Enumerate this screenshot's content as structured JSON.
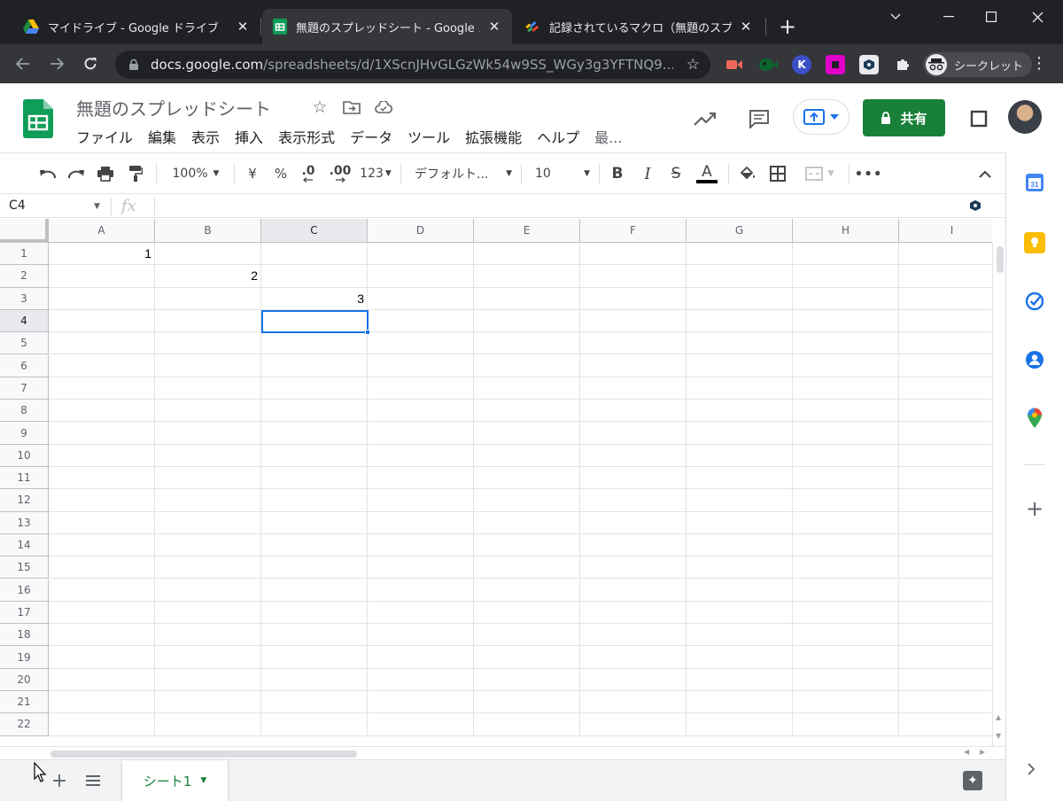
{
  "browser": {
    "tabs": [
      {
        "title": "マイドライブ - Google ドライブ",
        "active": false
      },
      {
        "title": "無題のスプレッドシート - Google スプ",
        "active": true
      },
      {
        "title": "記録されているマクロ（無題のスプレッ",
        "active": false
      }
    ],
    "url_host": "docs.google.com",
    "url_path": "/spreadsheets/d/1XScnJHvGLGzWk54w9SS_WGy3g3YFTNQ9...",
    "incognito_label": "シークレット"
  },
  "sheets": {
    "doc_title": "無題のスプレッドシート",
    "menu": [
      "ファイル",
      "編集",
      "表示",
      "挿入",
      "表示形式",
      "データ",
      "ツール",
      "拡張機能",
      "ヘルプ",
      "最..."
    ],
    "share_label": "共有",
    "brand_color": "#188038",
    "accent_color": "#1a73e8"
  },
  "toolbar": {
    "zoom": "100%",
    "currency": "¥",
    "percent": "%",
    "dec_decrease": ".0",
    "dec_increase": ".00",
    "number_format": "123",
    "font": "デフォルト...",
    "font_size": "10",
    "bold": "B",
    "italic": "I",
    "strike": "S",
    "text_color": "A"
  },
  "formula_bar": {
    "name_box": "C4",
    "fx": "fx"
  },
  "grid": {
    "columns": [
      "A",
      "B",
      "C",
      "D",
      "E",
      "F",
      "G",
      "H",
      "I"
    ],
    "rows": [
      "1",
      "2",
      "3",
      "4",
      "5",
      "6",
      "7",
      "8",
      "9",
      "10",
      "11",
      "12",
      "13",
      "14",
      "15",
      "16",
      "17",
      "18",
      "19",
      "20",
      "21",
      "22"
    ],
    "selected_cell": "C4",
    "cells": [
      {
        "ref": "A1",
        "value": "1"
      },
      {
        "ref": "B2",
        "value": "2"
      },
      {
        "ref": "C3",
        "value": "3"
      }
    ]
  },
  "sheet_tabs": {
    "active": "シート1"
  }
}
